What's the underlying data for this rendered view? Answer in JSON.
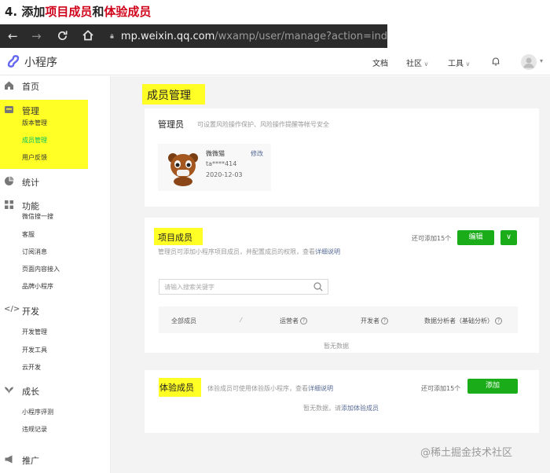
{
  "heading": {
    "prefix": "4. 添加",
    "part1": "项目成员",
    "mid": "和",
    "part2": "体验成员"
  },
  "browser": {
    "url_host": "mp.weixin.qq.com",
    "url_path": "/wxamp/user/manage?action=ind"
  },
  "topnav": {
    "brand": "小程序",
    "links": [
      "文档",
      "社区",
      "工具"
    ]
  },
  "sidebar": {
    "home": "首页",
    "manage": "管理",
    "manage_items": [
      "版本管理",
      "成员管理",
      "用户反馈"
    ],
    "stats": "统计",
    "features": "功能",
    "feature_items": [
      "微信搜一搜",
      "客服",
      "订阅消息",
      "页面内容接入",
      "品牌小程序"
    ],
    "dev": "开发",
    "dev_items": [
      "开发管理",
      "开发工具",
      "云开发"
    ],
    "growth": "成长",
    "growth_items": [
      "小程序评测",
      "违规记录"
    ],
    "promo": "推广"
  },
  "page": {
    "title": "成员管理"
  },
  "admin": {
    "title": "管理员",
    "desc": "可设置风险操作保护、风险操作提醒等帐号安全",
    "name": "微微猫",
    "id": "ta****414",
    "date": "2020-12-03",
    "edit": "修改"
  },
  "project": {
    "title": "项目成员",
    "desc": "管理员可添加小程序项目成员，并配置成员的权限，查看",
    "link": "详细说明",
    "remaining": "还可添加15个",
    "edit_btn": "编辑",
    "search_placeholder": "请输入搜索关键字",
    "columns": [
      "全部成员",
      "运营者",
      "开发者",
      "数据分析者（基础分析）"
    ],
    "empty": "暂无数据"
  },
  "trial": {
    "title": "体验成员",
    "desc": "体验成员可使用体验版小程序，查看",
    "link": "详细说明",
    "remaining": "还可添加15个",
    "add_btn": "添加",
    "empty_prefix": "暂无数据，请",
    "empty_link": "添加体验成员"
  },
  "watermark": "@稀土掘金技术社区",
  "colors": {
    "accent": "#1aad19",
    "highlight": "#ffff26",
    "link": "#576b95",
    "heading_red": "#d0021b"
  }
}
